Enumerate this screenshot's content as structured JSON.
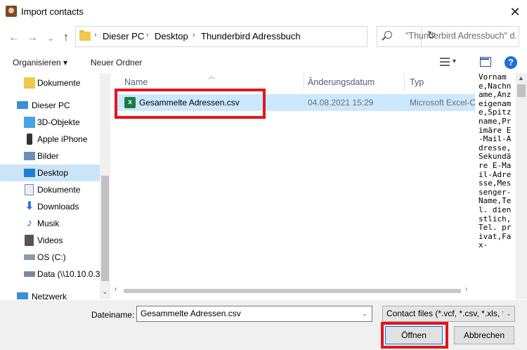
{
  "window": {
    "title": "Import contacts",
    "close_glyph": "✕"
  },
  "nav_buttons": {
    "back": "←",
    "forward": "→",
    "recent": "⌄",
    "up": "↑"
  },
  "breadcrumb": [
    "Dieser PC",
    "Desktop",
    "Thunderbird Adressbuch"
  ],
  "breadcrumb_sep": "›",
  "search": {
    "placeholder": "\"Thunderbird Adressbuch\" d..."
  },
  "toolbar": {
    "organize": "Organisieren ▾",
    "new_folder": "Neuer Ordner",
    "help": "?"
  },
  "sidebar": {
    "items": [
      {
        "label": "Dokumente",
        "icon": "folder-icon"
      },
      {
        "label": "Dieser PC",
        "icon": "computer-icon"
      },
      {
        "label": "3D-Objekte",
        "icon": "cube-icon"
      },
      {
        "label": "Apple iPhone",
        "icon": "phone-icon"
      },
      {
        "label": "Bilder",
        "icon": "pictures-icon"
      },
      {
        "label": "Desktop",
        "icon": "desktop-icon",
        "selected": true
      },
      {
        "label": "Dokumente",
        "icon": "documents-icon"
      },
      {
        "label": "Downloads",
        "icon": "download-icon"
      },
      {
        "label": "Musik",
        "icon": "music-icon"
      },
      {
        "label": "Videos",
        "icon": "video-icon"
      },
      {
        "label": "OS (C:)",
        "icon": "drive-icon"
      },
      {
        "label": "Data (\\\\10.10.0.3",
        "icon": "network-drive-icon"
      },
      {
        "label": "Netzwerk",
        "icon": "network-icon"
      }
    ]
  },
  "columns": {
    "name": "Name",
    "date": "Änderungsdatum",
    "type": "Typ"
  },
  "files": [
    {
      "name": "Gesammelte Adressen.csv",
      "date": "04.08.2021 15:29",
      "type": "Microsoft Excel-C"
    }
  ],
  "preview_text": "Vorname,Nachname,Anzeigename,Spitzname,Primäre E-Mail-Adresse,Sekundäre E-Mail-Adresse,Messenger-Name,Tel. dienstlich,Tel. privat,Fax-",
  "bottom": {
    "filename_label": "Dateiname:",
    "filename_value": "Gesammelte Adressen.csv",
    "filter_value": "Contact files (*.vcf, *.csv, *.xls, *",
    "open_button": "Öffnen",
    "cancel_button": "Abbrechen"
  },
  "colors": {
    "accent": "#0078d7",
    "selection": "#cce8ff",
    "highlight": "#e0171c"
  }
}
